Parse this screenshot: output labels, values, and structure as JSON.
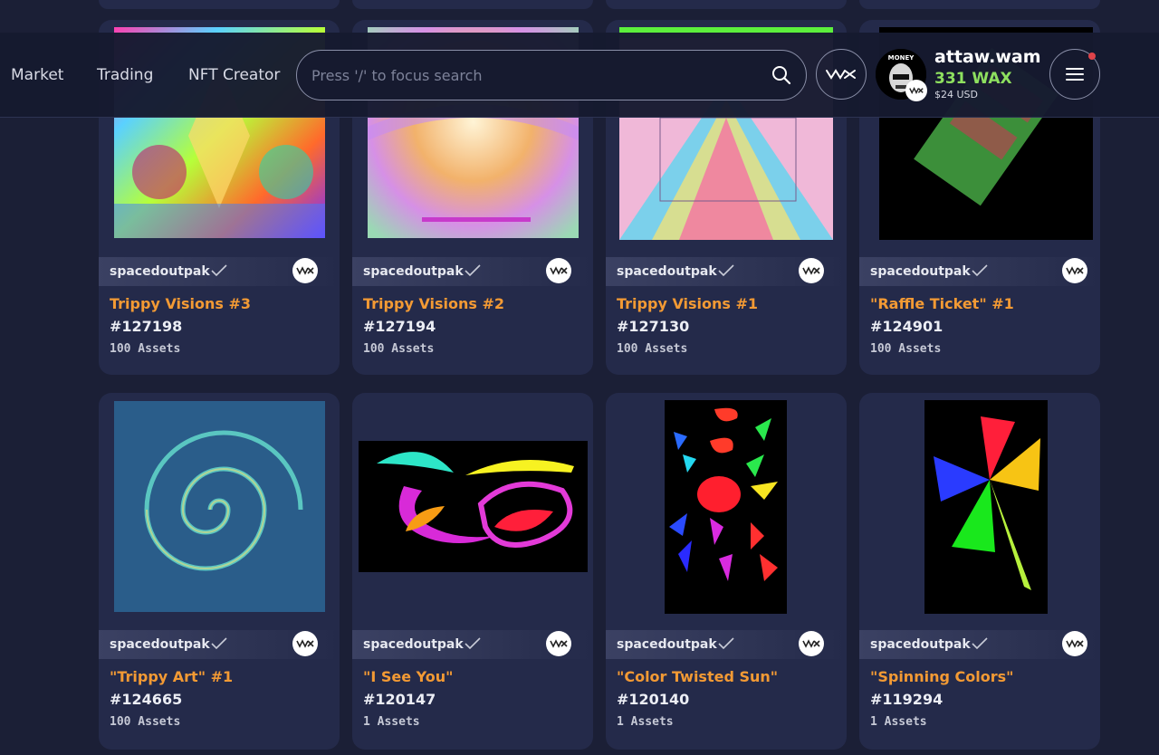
{
  "nav": {
    "market": "Market",
    "trading": "Trading",
    "nft_creator": "NFT Creator"
  },
  "search": {
    "placeholder": "Press '/' to focus search"
  },
  "user": {
    "name": "attaw.wam",
    "balance": "331 WAX",
    "usd": "$24 USD",
    "avatar_text": "MONEY"
  },
  "colors": {
    "background": "#1b1f36",
    "card": "#242a4a",
    "title_orange": "#f39a34",
    "balance_green": "#8ee05f",
    "notification_red": "#e0434a"
  },
  "cards": [
    {
      "creator": "spacedoutpak",
      "title": "Trippy Visions #3",
      "number": "#127198",
      "assets": "100 Assets",
      "art": "psychedelic-collage"
    },
    {
      "creator": "spacedoutpak",
      "title": "Trippy Visions #2",
      "number": "#127194",
      "assets": "100 Assets",
      "art": "psychedelic-collage"
    },
    {
      "creator": "spacedoutpak",
      "title": "Trippy Visions #1",
      "number": "#127130",
      "assets": "100 Assets",
      "art": "psychedelic-collage"
    },
    {
      "creator": "spacedoutpak",
      "title": "\"Raffle Ticket\" #1",
      "number": "#124901",
      "assets": "100 Assets",
      "art": "green-ticket"
    },
    {
      "creator": "spacedoutpak",
      "title": "\"Trippy Art\" #1",
      "number": "#124665",
      "assets": "100 Assets",
      "art": "blue-spiral"
    },
    {
      "creator": "spacedoutpak",
      "title": "\"I See You\"",
      "number": "#120147",
      "assets": "1 Assets",
      "art": "colorful-eyes"
    },
    {
      "creator": "spacedoutpak",
      "title": "\"Color Twisted Sun\"",
      "number": "#120140",
      "assets": "1 Assets",
      "art": "twisted-sun"
    },
    {
      "creator": "spacedoutpak",
      "title": "\"Spinning Colors\"",
      "number": "#119294",
      "assets": "1 Assets",
      "art": "pinwheel"
    }
  ]
}
